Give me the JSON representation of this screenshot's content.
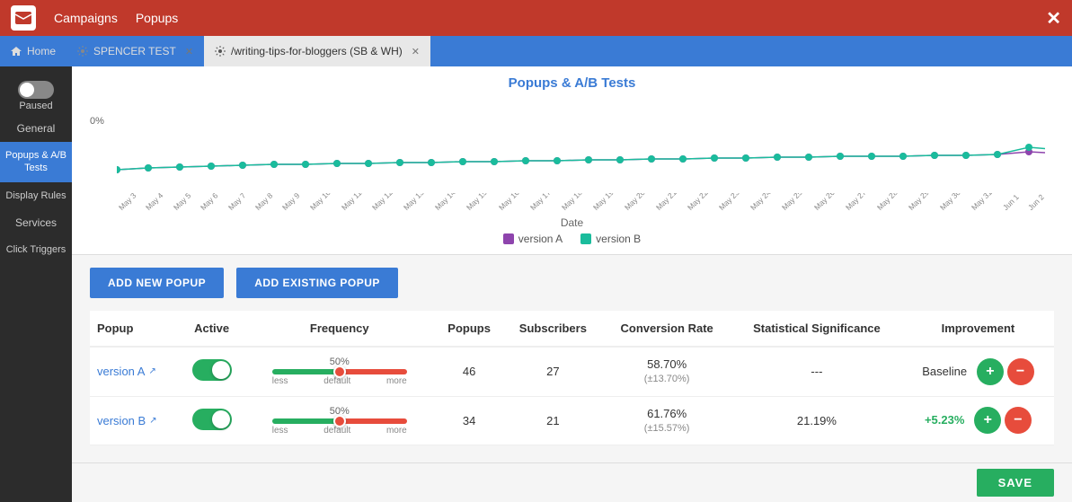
{
  "titleBar": {
    "appName": "Campaigns",
    "nav2": "Popups",
    "closeBtn": "✕"
  },
  "tabs": [
    {
      "id": "home",
      "label": "Home",
      "icon": "home",
      "active": false,
      "closable": false
    },
    {
      "id": "spencer",
      "label": "SPENCER TEST",
      "icon": "settings",
      "active": false,
      "closable": true
    },
    {
      "id": "writing",
      "label": "/writing-tips-for-bloggers (SB & WH)",
      "icon": "settings",
      "active": true,
      "closable": true
    }
  ],
  "sidebar": {
    "toggleState": "off",
    "pausedLabel": "Paused",
    "generalLabel": "General",
    "popupsLabel": "Popups & A/B Tests",
    "displayRulesLabel": "Display Rules",
    "servicesLabel": "Services",
    "clickTriggersLabel": "Click Triggers"
  },
  "chart": {
    "title": "Popups & A/B Tests",
    "yLabel": "0%",
    "xAxisLabel": "Date",
    "dates": [
      "May 3",
      "May 4",
      "May 5",
      "May 6",
      "May 7",
      "May 8",
      "May 9",
      "May 10",
      "May 11",
      "May 12",
      "May 13",
      "May 14",
      "May 15",
      "May 16",
      "May 17",
      "May 18",
      "May 19",
      "May 20",
      "May 21",
      "May 22",
      "May 23",
      "May 24",
      "May 25",
      "May 26",
      "May 27",
      "May 28",
      "May 29",
      "May 30",
      "May 31",
      "Jun 1",
      "Jun 2"
    ],
    "legend": {
      "versionA": "version A",
      "versionAColor": "#8e44ad",
      "versionB": "version B",
      "versionBColor": "#1abc9c"
    }
  },
  "buttons": {
    "addNew": "ADD NEW POPUP",
    "addExisting": "ADD EXISTING POPUP"
  },
  "table": {
    "headers": {
      "popup": "Popup",
      "active": "Active",
      "frequency": "Frequency",
      "popups": "Popups",
      "subscribers": "Subscribers",
      "conversionRate": "Conversion Rate",
      "statisticalSignificance": "Statistical Significance",
      "improvement": "Improvement"
    },
    "rows": [
      {
        "popup": "version A",
        "active": true,
        "sliderPct": "50%",
        "popups": "46",
        "subscribers": "27",
        "conversionMain": "58.70%",
        "conversionSub": "(±13.70%)",
        "statisticalSignificance": "---",
        "improvement": "Baseline",
        "improvementType": "baseline"
      },
      {
        "popup": "version B",
        "active": true,
        "sliderPct": "50%",
        "popups": "34",
        "subscribers": "21",
        "conversionMain": "61.76%",
        "conversionSub": "(±15.57%)",
        "statisticalSignificance": "21.19%",
        "improvement": "+5.23%",
        "improvementType": "positive"
      }
    ]
  },
  "saveBtn": "SAVE"
}
